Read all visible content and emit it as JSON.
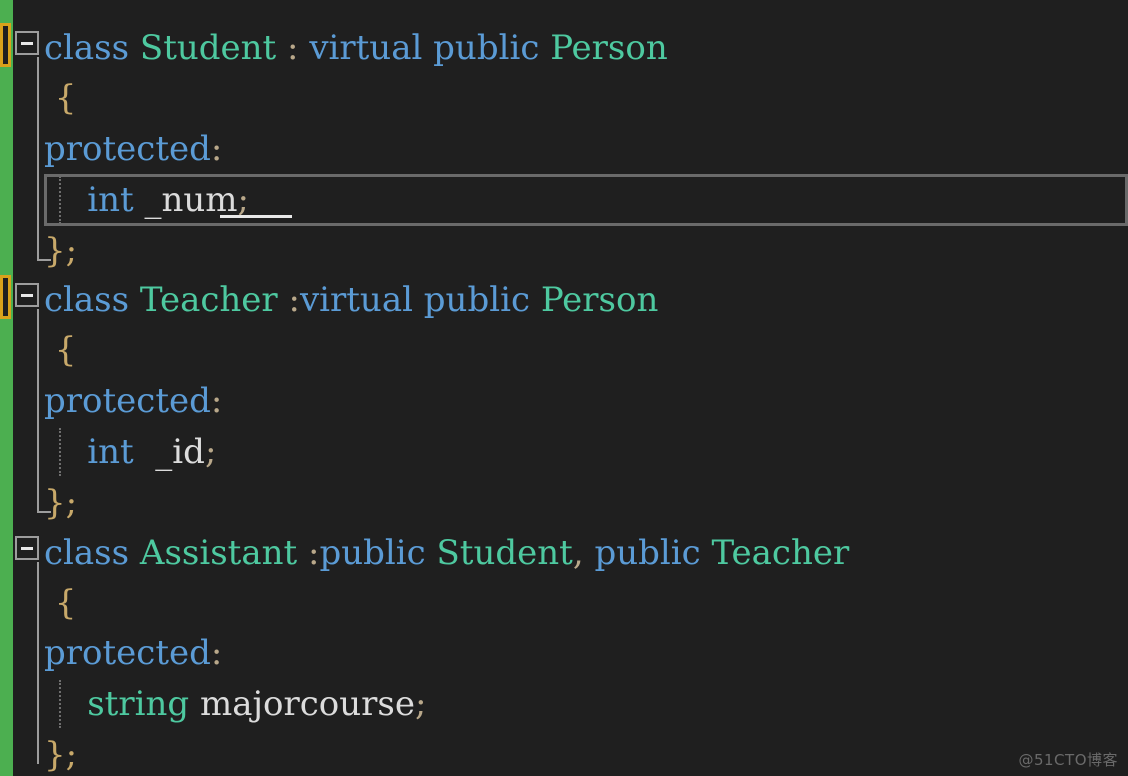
{
  "editor": {
    "background_color": "#1f1f1f",
    "change_bar_color": "#4caf50",
    "bookmark_border_color": "#d9a21b",
    "current_line_border_color": "#6a6a6a",
    "keyword_color": "#5b9bd5",
    "type_color": "#4ec9a0",
    "identifier_color": "#dcdcdc",
    "punctuation_color": "#b9a88a"
  },
  "watermark": {
    "text": "@51CTO博客"
  },
  "fold_markers": [
    {
      "name": "fold-student",
      "state": "expanded",
      "glyph": "−"
    },
    {
      "name": "fold-teacher",
      "state": "expanded",
      "glyph": "−"
    },
    {
      "name": "fold-assistant",
      "state": "expanded",
      "glyph": "−"
    }
  ],
  "code": {
    "lines": [
      {
        "n": 1,
        "text": "class Student : virtual public Person",
        "tokens": [
          {
            "t": "class",
            "c": "kw"
          },
          {
            "t": " ",
            "c": "plain"
          },
          {
            "t": "Student",
            "c": "type"
          },
          {
            "t": " ",
            "c": "plain"
          },
          {
            "t": ":",
            "c": "punct"
          },
          {
            "t": " ",
            "c": "plain"
          },
          {
            "t": "virtual",
            "c": "kw"
          },
          {
            "t": " ",
            "c": "plain"
          },
          {
            "t": "public",
            "c": "kw"
          },
          {
            "t": " ",
            "c": "plain"
          },
          {
            "t": "Person",
            "c": "type"
          }
        ]
      },
      {
        "n": 2,
        "text": "{",
        "tokens": [
          {
            "t": " {",
            "c": "brace"
          }
        ]
      },
      {
        "n": 3,
        "text": "protected:",
        "tokens": [
          {
            "t": "protected",
            "c": "kw"
          },
          {
            "t": ":",
            "c": "punct"
          }
        ]
      },
      {
        "n": 4,
        "text": "    int _num;",
        "tokens": [
          {
            "t": "    ",
            "c": "plain"
          },
          {
            "t": "int",
            "c": "kw"
          },
          {
            "t": " ",
            "c": "plain"
          },
          {
            "t": "_num",
            "c": "plain"
          },
          {
            "t": ";",
            "c": "punct"
          }
        ]
      },
      {
        "n": 5,
        "text": "};",
        "tokens": [
          {
            "t": "};",
            "c": "brace"
          }
        ]
      },
      {
        "n": 6,
        "text": "class Teacher :virtual public Person",
        "tokens": [
          {
            "t": "class",
            "c": "kw"
          },
          {
            "t": " ",
            "c": "plain"
          },
          {
            "t": "Teacher",
            "c": "type"
          },
          {
            "t": " ",
            "c": "plain"
          },
          {
            "t": ":",
            "c": "punct"
          },
          {
            "t": "virtual",
            "c": "kw"
          },
          {
            "t": " ",
            "c": "plain"
          },
          {
            "t": "public",
            "c": "kw"
          },
          {
            "t": " ",
            "c": "plain"
          },
          {
            "t": "Person",
            "c": "type"
          }
        ]
      },
      {
        "n": 7,
        "text": "{",
        "tokens": [
          {
            "t": " {",
            "c": "brace"
          }
        ]
      },
      {
        "n": 8,
        "text": "protected:",
        "tokens": [
          {
            "t": "protected",
            "c": "kw"
          },
          {
            "t": ":",
            "c": "punct"
          }
        ]
      },
      {
        "n": 9,
        "text": "    int  _id;",
        "tokens": [
          {
            "t": "    ",
            "c": "plain"
          },
          {
            "t": "int",
            "c": "kw"
          },
          {
            "t": "  ",
            "c": "plain"
          },
          {
            "t": "_id",
            "c": "plain"
          },
          {
            "t": ";",
            "c": "punct"
          }
        ]
      },
      {
        "n": 10,
        "text": "};",
        "tokens": [
          {
            "t": "};",
            "c": "brace"
          }
        ]
      },
      {
        "n": 11,
        "text": "class Assistant :public Student, public Teacher",
        "tokens": [
          {
            "t": "class",
            "c": "kw"
          },
          {
            "t": " ",
            "c": "plain"
          },
          {
            "t": "Assistant",
            "c": "type"
          },
          {
            "t": " ",
            "c": "plain"
          },
          {
            "t": ":",
            "c": "punct"
          },
          {
            "t": "public",
            "c": "kw"
          },
          {
            "t": " ",
            "c": "plain"
          },
          {
            "t": "Student",
            "c": "type"
          },
          {
            "t": ",",
            "c": "punct"
          },
          {
            "t": " ",
            "c": "plain"
          },
          {
            "t": "public",
            "c": "kw"
          },
          {
            "t": " ",
            "c": "plain"
          },
          {
            "t": "Teacher",
            "c": "type"
          }
        ]
      },
      {
        "n": 12,
        "text": "{",
        "tokens": [
          {
            "t": " {",
            "c": "brace"
          }
        ]
      },
      {
        "n": 13,
        "text": "protected:",
        "tokens": [
          {
            "t": "protected",
            "c": "kw"
          },
          {
            "t": ":",
            "c": "punct"
          }
        ]
      },
      {
        "n": 14,
        "text": "    string majorcourse;",
        "tokens": [
          {
            "t": "    ",
            "c": "plain"
          },
          {
            "t": "string",
            "c": "type"
          },
          {
            "t": " ",
            "c": "plain"
          },
          {
            "t": "majorcourse",
            "c": "plain"
          },
          {
            "t": ";",
            "c": "punct"
          }
        ]
      },
      {
        "n": 15,
        "text": "};",
        "tokens": [
          {
            "t": "};",
            "c": "brace"
          }
        ]
      }
    ]
  }
}
